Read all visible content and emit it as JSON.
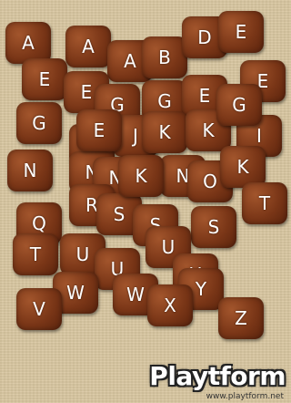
{
  "tiles": [
    "A",
    "A",
    "A",
    "B",
    "D",
    "E",
    "E",
    "E",
    "G",
    "G",
    "E",
    "E",
    "G",
    "H",
    "J",
    "K",
    "K",
    "I",
    "N",
    "N",
    "N",
    "N",
    "O",
    "K",
    "Q",
    "R",
    "S",
    "S",
    "S",
    "T",
    "T",
    "U",
    "U",
    "U",
    "U",
    "W",
    "W",
    "Y",
    "X",
    "V",
    "Z",
    "E",
    "G",
    "K"
  ],
  "watermark": {
    "brand": "Playtform",
    "url": "www.playtform.net"
  }
}
